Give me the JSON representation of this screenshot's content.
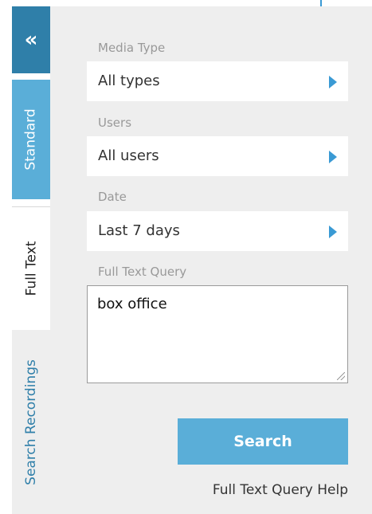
{
  "rail": {
    "collapse_icon": "«",
    "tabs": [
      {
        "label": "Standard"
      },
      {
        "label": "Full Text"
      },
      {
        "label": "Search Recordings"
      }
    ]
  },
  "form": {
    "media_type": {
      "label": "Media Type",
      "value": "All types"
    },
    "users": {
      "label": "Users",
      "value": "All users"
    },
    "date": {
      "label": "Date",
      "value": "Last 7 days"
    },
    "query": {
      "label": "Full Text Query",
      "value": "box office"
    },
    "search_label": "Search",
    "help_link": "Full Text Query Help"
  },
  "colors": {
    "primary_dark": "#2f7fa9",
    "primary": "#5aaed8",
    "panel_bg": "#eeeeee"
  }
}
